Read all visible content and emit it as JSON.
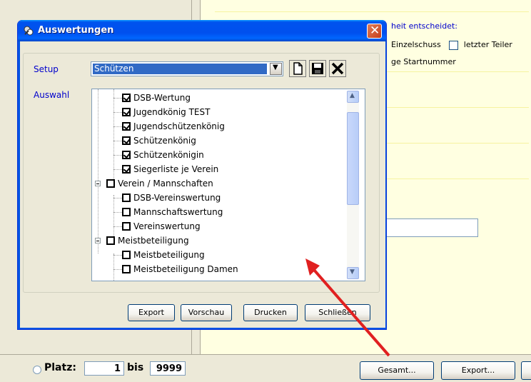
{
  "background": {
    "hint_text": "heit entscheidet:",
    "checkbox_einzelschuss": "Einzelschuss",
    "checkbox_letzter_teiler": "letzter Teiler",
    "startnummer_text": "ge Startnummer",
    "platz_label": "Platz:",
    "platz_from": "1",
    "bis_label": "bis",
    "platz_to": "9999",
    "gesamt_button": "Gesamt...",
    "export_button": "Export..."
  },
  "dialog": {
    "title": "Auswertungen",
    "setup_label": "Setup",
    "setup_value": "Schützen",
    "auswahl_label": "Auswahl",
    "tree_items": [
      {
        "label": "DSB-Wertung",
        "checked": true,
        "level": 2
      },
      {
        "label": "Jugendkönig TEST",
        "checked": true,
        "level": 2
      },
      {
        "label": "Jugendschützenkönig",
        "checked": true,
        "level": 2
      },
      {
        "label": "Schützenkönig",
        "checked": true,
        "level": 2
      },
      {
        "label": "Schützenkönigin",
        "checked": true,
        "level": 2
      },
      {
        "label": "Siegerliste je Verein",
        "checked": true,
        "level": 2
      },
      {
        "label": "Verein / Mannschaften",
        "checked": false,
        "level": 1
      },
      {
        "label": "DSB-Vereinswertung",
        "checked": false,
        "level": 2
      },
      {
        "label": "Mannschaftswertung",
        "checked": false,
        "level": 2
      },
      {
        "label": "Vereinswertung",
        "checked": false,
        "level": 2
      },
      {
        "label": "Meistbeteiligung",
        "checked": false,
        "level": 1
      },
      {
        "label": "Meistbeteiligung",
        "checked": false,
        "level": 2
      },
      {
        "label": "Meistbeteiligung Damen",
        "checked": false,
        "level": 2
      }
    ],
    "buttons": {
      "export": "Export",
      "vorschau": "Vorschau",
      "drucken": "Drucken",
      "schliessen": "Schließen"
    }
  },
  "colors": {
    "titlebar": "#0054e3",
    "label_blue": "#0000cc",
    "selection": "#316ac5",
    "annotation_arrow": "#e02020"
  }
}
